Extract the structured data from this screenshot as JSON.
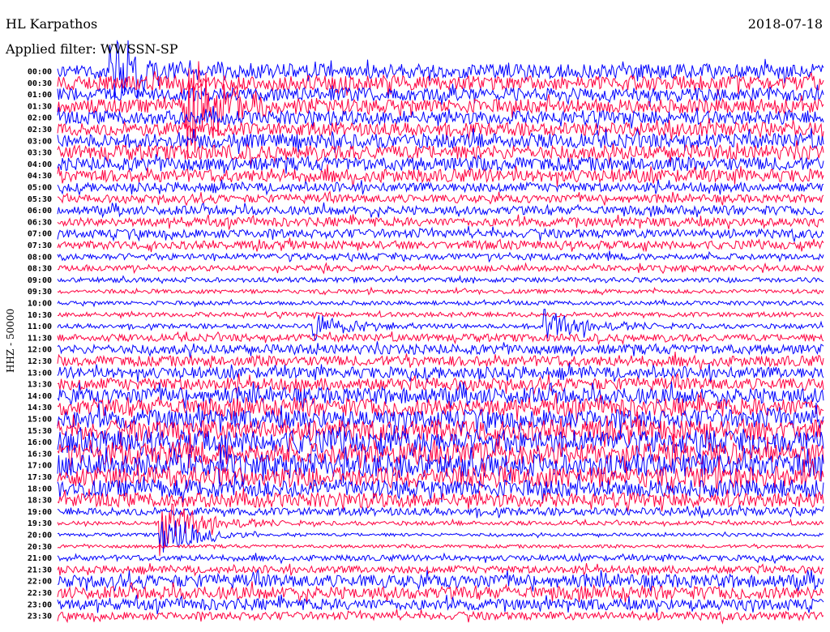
{
  "header": {
    "station": "HL Karpathos",
    "filter": "Applied filter: WWSSN-SP",
    "date": "2018-07-18"
  },
  "chart_data": {
    "type": "line",
    "title": "HL Karpathos",
    "ylabel": "HHZ - 50000",
    "colors": [
      "#0000ff",
      "#ff0040"
    ],
    "rows": [
      "00:00",
      "00:30",
      "01:00",
      "01:30",
      "02:00",
      "02:30",
      "03:00",
      "03:30",
      "04:00",
      "04:30",
      "05:00",
      "05:30",
      "06:00",
      "06:30",
      "07:00",
      "07:30",
      "08:00",
      "08:30",
      "09:00",
      "09:30",
      "10:00",
      "10:30",
      "11:00",
      "11:30",
      "12:00",
      "12:30",
      "13:00",
      "13:30",
      "14:00",
      "14:30",
      "15:00",
      "15:30",
      "16:00",
      "16:30",
      "17:00",
      "17:30",
      "18:00",
      "18:30",
      "19:00",
      "19:30",
      "20:00",
      "20:30",
      "21:00",
      "21:30",
      "22:00",
      "22:30",
      "23:00",
      "23:30"
    ],
    "noise_level": [
      0.9,
      0.9,
      0.85,
      0.9,
      0.85,
      0.85,
      0.9,
      0.9,
      0.85,
      0.8,
      0.55,
      0.5,
      0.55,
      0.55,
      0.55,
      0.5,
      0.4,
      0.35,
      0.3,
      0.25,
      0.25,
      0.3,
      0.3,
      0.45,
      0.6,
      0.65,
      0.7,
      0.75,
      1.0,
      1.1,
      1.2,
      1.3,
      1.4,
      1.4,
      1.4,
      1.3,
      1.1,
      0.9,
      0.5,
      0.25,
      0.2,
      0.2,
      0.35,
      0.45,
      0.8,
      0.8,
      0.7,
      0.5
    ],
    "events": [
      {
        "row": 0,
        "at_minute": 2,
        "amp": 4
      },
      {
        "row": 3,
        "at_minute": 5,
        "amp": 5
      },
      {
        "row": 39,
        "at_minute": 4,
        "amp": 3
      },
      {
        "row": 40,
        "at_minute": 4,
        "amp": 2
      },
      {
        "row": 22,
        "at_minute": 19,
        "amp": 2
      },
      {
        "row": 22,
        "at_minute": 10,
        "amp": 1.5
      }
    ]
  }
}
